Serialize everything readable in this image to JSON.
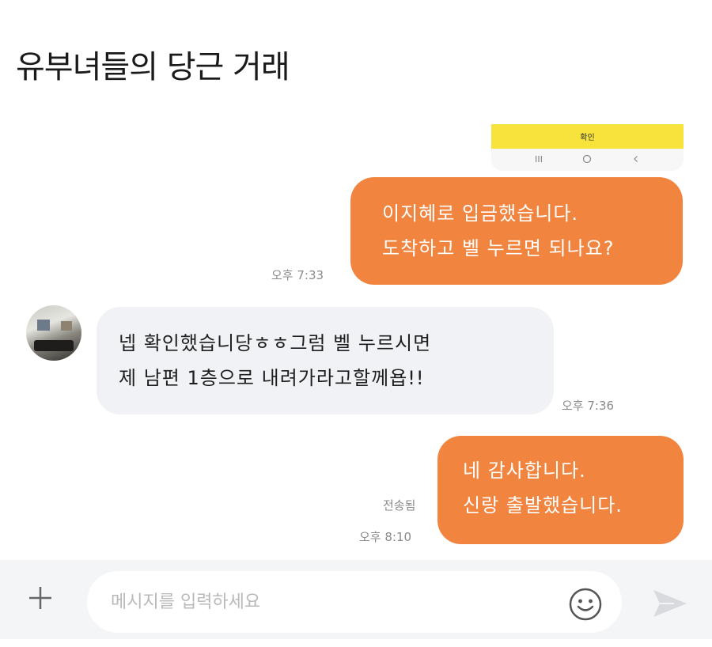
{
  "post": {
    "title": "유부녀들의 당근 거래"
  },
  "screenshot_top": {
    "confirm_label": "확인"
  },
  "messages": [
    {
      "lines": [
        "이지혜로 입금했습니다.",
        "도착하고 벨 누르면 되나요?"
      ],
      "time": "오후 7:33"
    },
    {
      "lines": [
        "넵 확인했습니당ㅎㅎ그럼 벨 누르시면",
        "제 남편 1층으로 내려가라고할께욥!!"
      ],
      "time": "오후 7:36"
    },
    {
      "lines": [
        "네 감사합니다.",
        "신랑 출발했습니다."
      ],
      "status": "전송됨",
      "time": "오후 8:10"
    }
  ],
  "composer": {
    "placeholder": "메시지를 입력하세요"
  },
  "icons": {
    "plus": "plus-icon",
    "emoji": "smiley-icon",
    "send": "send-arrow-icon",
    "nav": [
      "recents-icon",
      "home-icon",
      "back-icon"
    ]
  },
  "colors": {
    "sent_bubble": "#f1853f",
    "received_bubble": "#f0f2f5",
    "confirm_bar": "#f7e33c"
  }
}
